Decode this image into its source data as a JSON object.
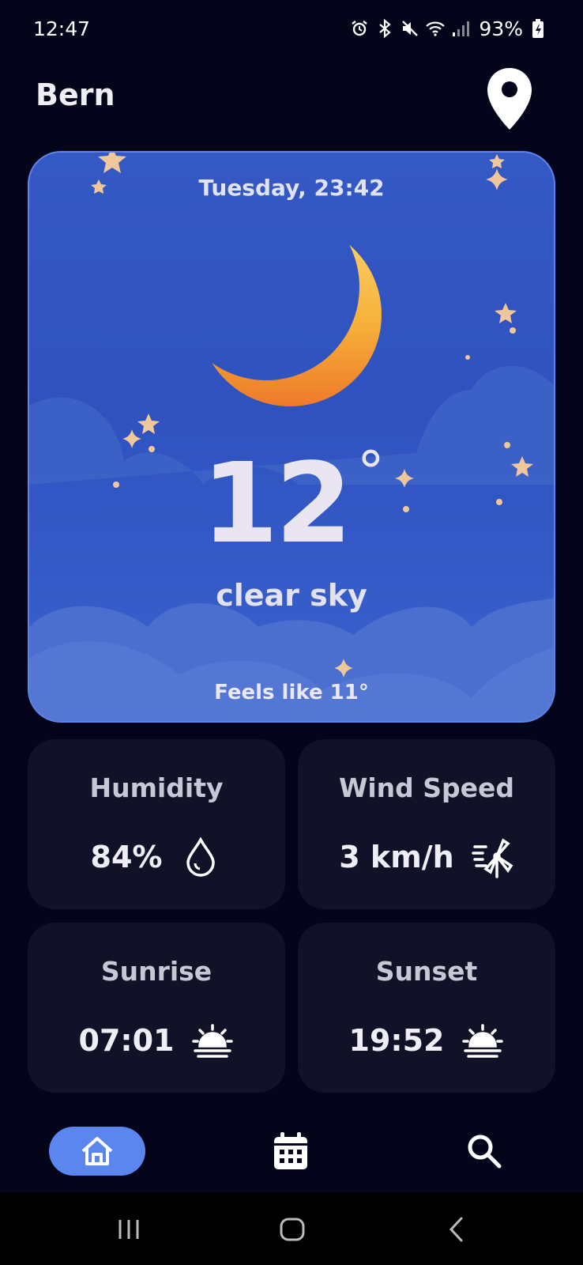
{
  "status_bar": {
    "time": "12:47",
    "battery": "93%",
    "icons": [
      "alarm-icon",
      "bluetooth-icon",
      "mute-icon",
      "wifi-icon",
      "signal-icon",
      "battery-charging-icon"
    ]
  },
  "header": {
    "city": "Bern",
    "location_icon": "location-pin-icon"
  },
  "weather": {
    "datetime": "Tuesday, 23:42",
    "temperature": "12",
    "degree": "°",
    "condition": "clear sky",
    "feels_like": "Feels like 11°",
    "illustration": "crescent-moon-night-sky"
  },
  "tiles": [
    {
      "title": "Humidity",
      "value": "84%",
      "icon": "water-drop-icon"
    },
    {
      "title": "Wind Speed",
      "value": "3 km/h",
      "icon": "wind-turbine-icon"
    },
    {
      "title": "Sunrise",
      "value": "07:01",
      "icon": "sunrise-icon"
    },
    {
      "title": "Sunset",
      "value": "19:52",
      "icon": "sunset-icon"
    }
  ],
  "bottom_nav": {
    "items": [
      "home-icon",
      "calendar-icon",
      "search-icon"
    ],
    "active": "home-icon",
    "active_color": "#5a86ee"
  },
  "colors": {
    "background": "#04051b",
    "card": "#3458c4",
    "tile": "#111228"
  }
}
